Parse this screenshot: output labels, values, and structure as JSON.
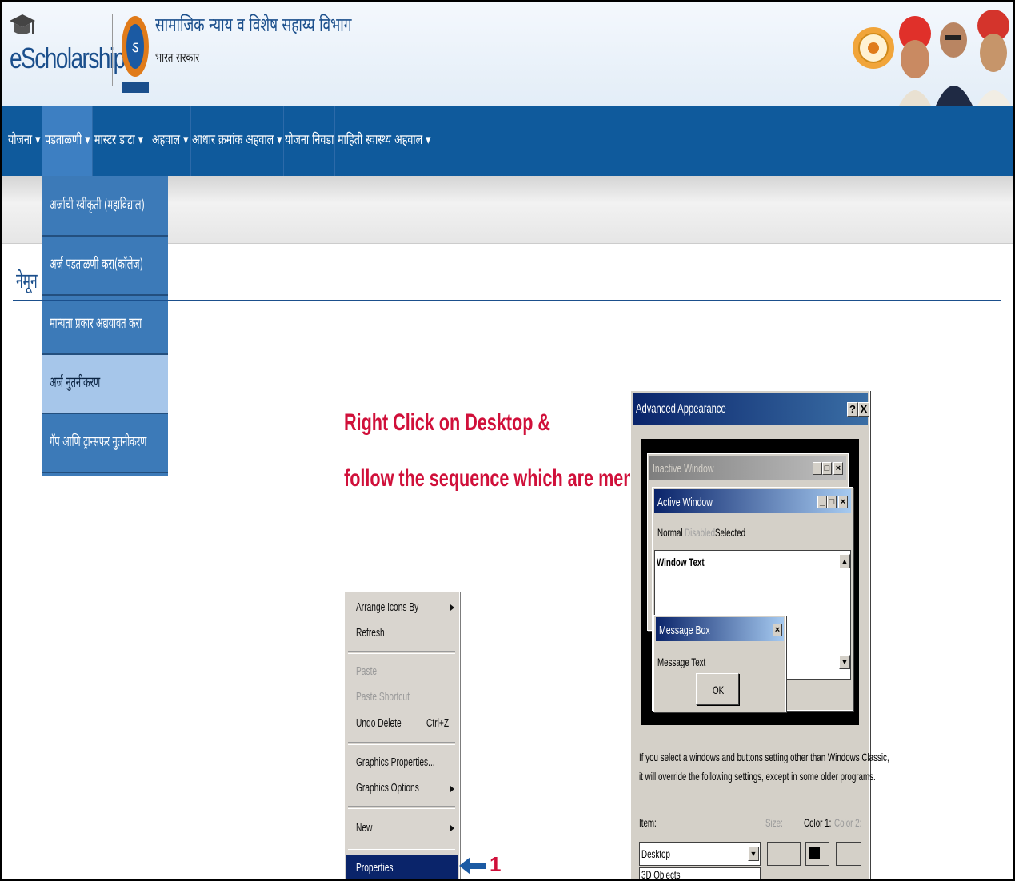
{
  "header": {
    "logo_text": "eScholarship",
    "dept_title": "सामाजिक न्याय व विशेष सहाय्य विभाग",
    "subtitle": "भारत सरकार"
  },
  "nav": {
    "items": [
      "योजना",
      "पडताळणी",
      "मास्टर डाटा",
      "अहवाल",
      "आधार क्रमांक अहवाल",
      "योजना निवडा",
      "माहिती स्वास्थ्य अहवाल"
    ]
  },
  "dropdown": {
    "items": [
      "अर्जाची स्वीकृती (महाविद्याल)",
      "अर्ज पडताळणी करा(कॉलेज)",
      "मान्यता प्रकार अद्ययावत करा",
      "अर्ज नुतनीकरण",
      "गॅप आणि ट्रान्सफर नुतनीकरण"
    ]
  },
  "page": {
    "heading": "नेमून"
  },
  "instructions": {
    "line1": "Right Click on Desktop &",
    "line2": "follow the sequence which are mention."
  },
  "context_menu": {
    "items": [
      {
        "label": "Arrange Icons By",
        "submenu": true,
        "disabled": false
      },
      {
        "label": "Refresh",
        "disabled": false
      },
      {
        "label": "Paste",
        "disabled": true
      },
      {
        "label": "Paste Shortcut",
        "disabled": true
      },
      {
        "label": "Undo Delete",
        "shortcut": "Ctrl+Z",
        "disabled": false
      },
      {
        "label": "Graphics Properties...",
        "disabled": false
      },
      {
        "label": "Graphics Options",
        "submenu": true,
        "disabled": false
      },
      {
        "label": "New",
        "submenu": true,
        "disabled": false
      },
      {
        "label": "Properties",
        "selected": true,
        "disabled": false
      }
    ],
    "step_number": "1"
  },
  "dialog": {
    "title": "Advanced Appearance",
    "help": "?",
    "close": "X",
    "inactive_window": "Inactive Window",
    "active_window": "Active Window",
    "menu_normal": "Normal",
    "menu_disabled": "Disabled",
    "menu_selected": "Selected",
    "window_text": "Window Text",
    "message_box": "Message Box",
    "message_text": "Message Text",
    "ok": "OK",
    "desc_line1": "If you select a windows and buttons setting other than Windows Classic,",
    "desc_line2": "it will override the following settings, except in some older programs.",
    "item_label": "Item:",
    "size_label": "Size:",
    "color1_label": "Color 1:",
    "color2_label": "Color 2:",
    "item_value": "Desktop",
    "item_below": "3D Objects"
  },
  "colors": {
    "nav_blue": "#0f5a9c",
    "dropdown_blue": "#3c7ab8",
    "highlight": "#a6c6ea",
    "instruction_red": "#d0103a",
    "win_title_blue": "#0a246a"
  }
}
